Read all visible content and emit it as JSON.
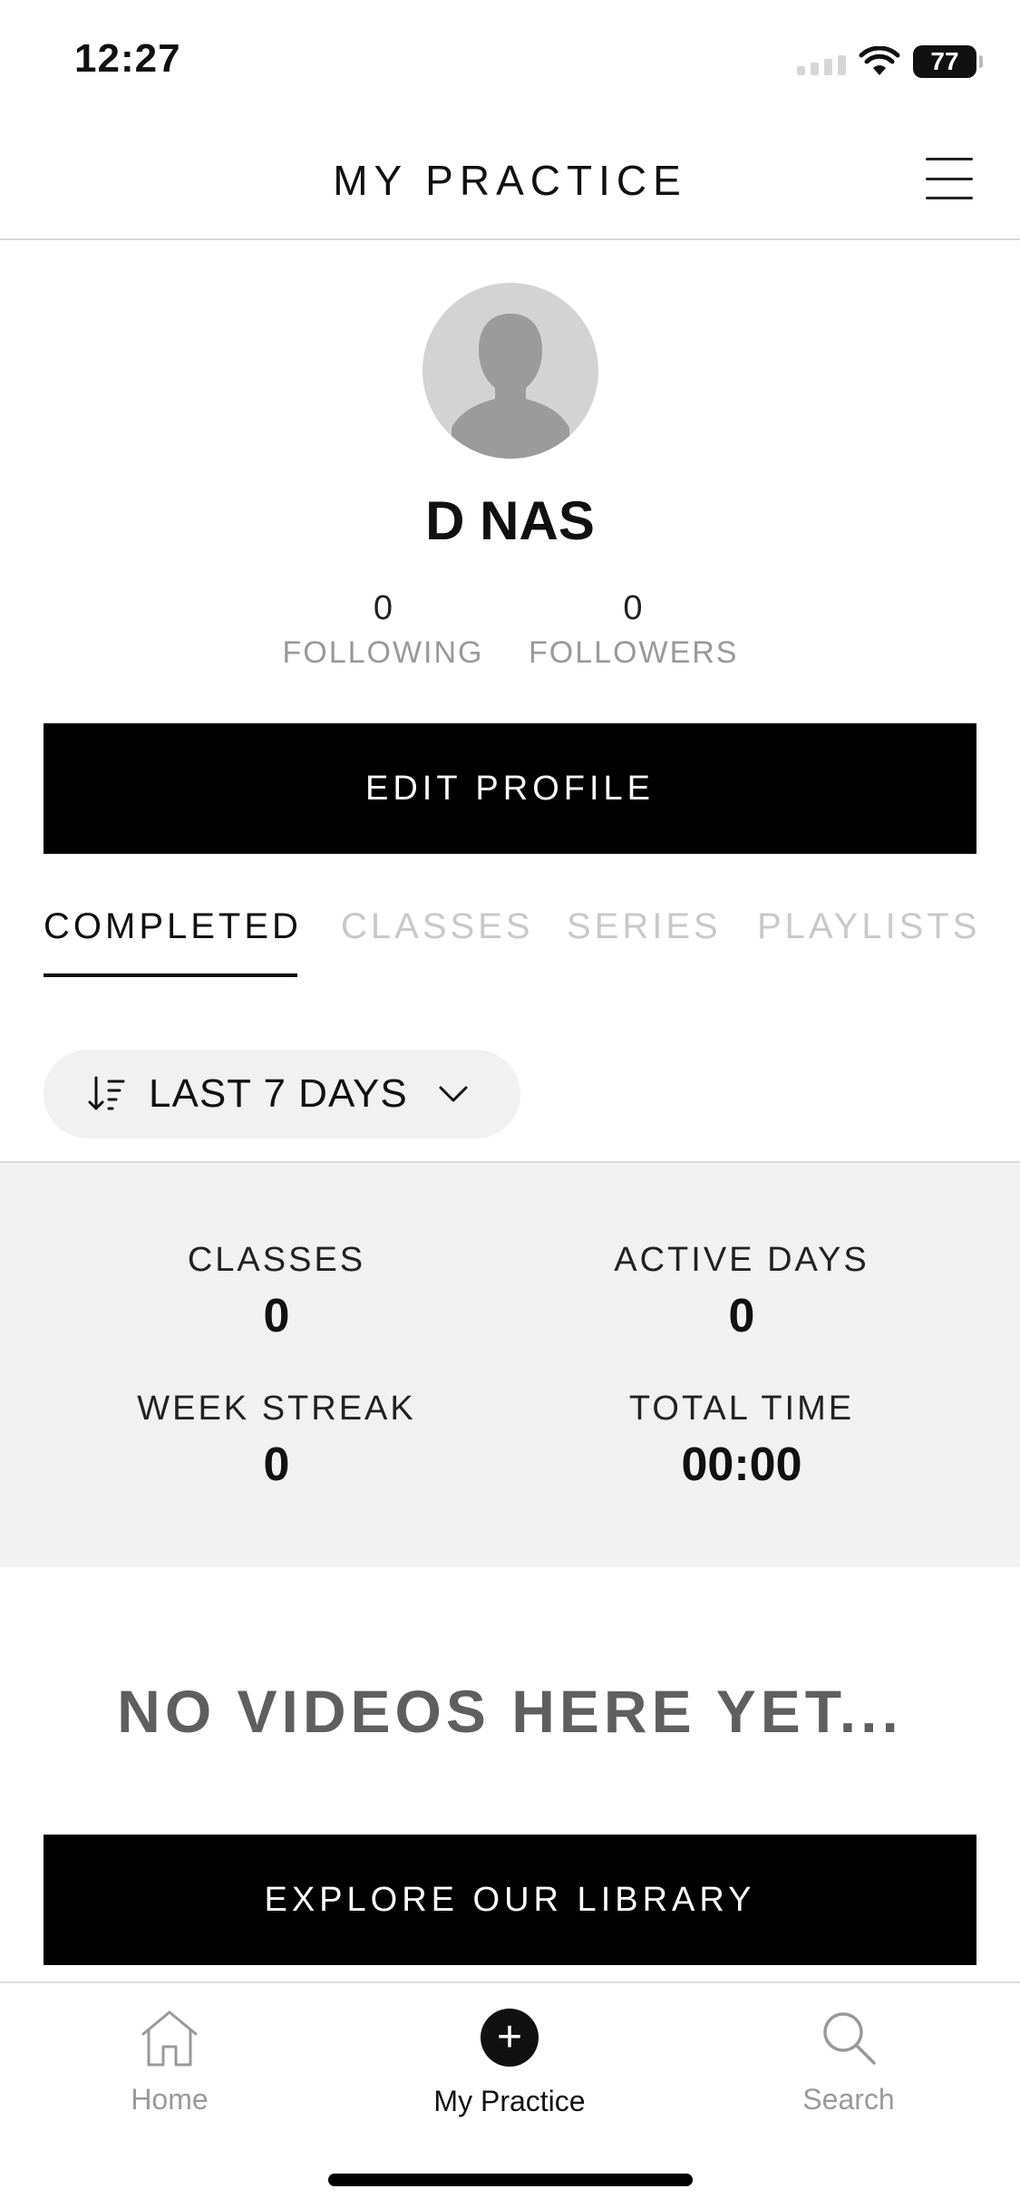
{
  "status_bar": {
    "time": "12:27",
    "battery": "77"
  },
  "header": {
    "title": "MY PRACTICE"
  },
  "profile": {
    "name": "D NAS",
    "following_count": "0",
    "following_label": "FOLLOWING",
    "followers_count": "0",
    "followers_label": "FOLLOWERS",
    "edit_button": "EDIT PROFILE"
  },
  "tabs": [
    {
      "label": "COMPLETED",
      "active": true
    },
    {
      "label": "CLASSES",
      "active": false
    },
    {
      "label": "SERIES",
      "active": false
    },
    {
      "label": "PLAYLISTS",
      "active": false
    }
  ],
  "filter": {
    "label": "LAST 7 DAYS"
  },
  "stats": {
    "classes_label": "CLASSES",
    "classes_value": "0",
    "active_days_label": "ACTIVE DAYS",
    "active_days_value": "0",
    "week_streak_label": "WEEK STREAK",
    "week_streak_value": "0",
    "total_time_label": "TOTAL TIME",
    "total_time_value": "00:00"
  },
  "empty_state": {
    "message": "NO VIDEOS HERE YET...",
    "button": "EXPLORE OUR LIBRARY"
  },
  "bottom_nav": [
    {
      "label": "Home",
      "icon": "home-icon",
      "active": false
    },
    {
      "label": "My Practice",
      "icon": "plus-icon",
      "active": true
    },
    {
      "label": "Search",
      "icon": "search-icon",
      "active": false
    }
  ]
}
